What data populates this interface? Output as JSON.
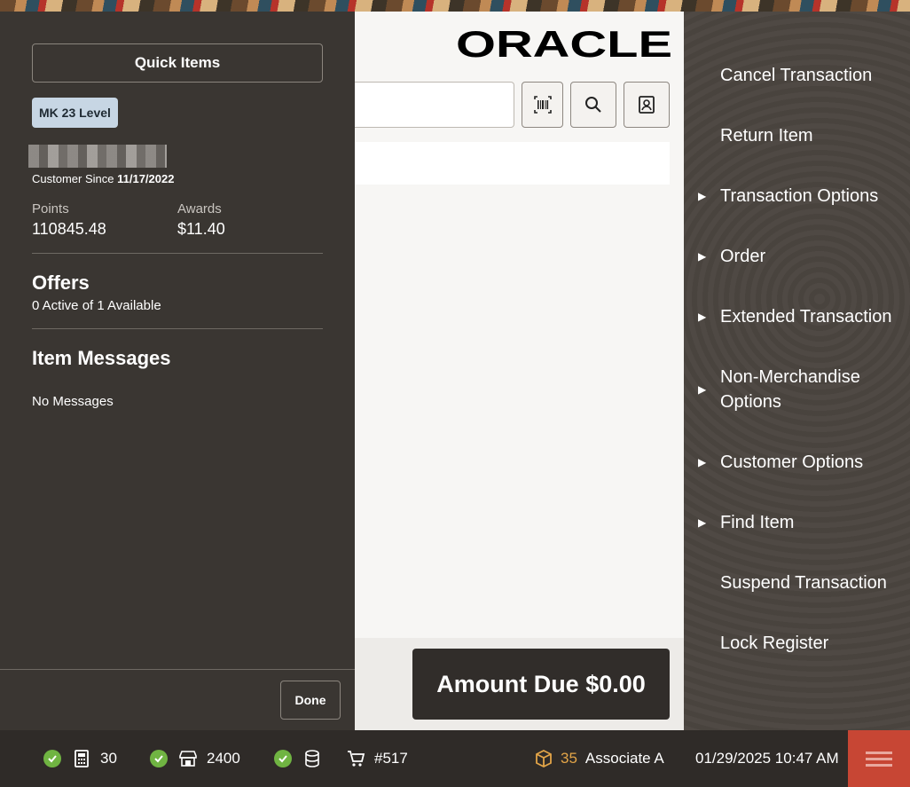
{
  "brand": {
    "logo_text": "ORACLE"
  },
  "left_panel": {
    "quick_items_label": "Quick Items",
    "level_badge": "MK 23 Level",
    "customer_since_label": "Customer Since",
    "customer_since_date": "11/17/2022",
    "points_label": "Points",
    "points_value": "110845.48",
    "awards_label": "Awards",
    "awards_value": "$11.40",
    "offers_title": "Offers",
    "offers_sub": "0 Active of 1 Available",
    "messages_title": "Item Messages",
    "messages_sub": "No Messages",
    "done_label": "Done"
  },
  "center": {
    "search_value": "",
    "amount_due_label": "Amount Due $0.00"
  },
  "menu": [
    {
      "label": "Cancel Transaction",
      "has_submenu": false
    },
    {
      "label": "Return Item",
      "has_submenu": false
    },
    {
      "label": "Transaction Options",
      "has_submenu": true
    },
    {
      "label": "Order",
      "has_submenu": true
    },
    {
      "label": "Extended Transaction",
      "has_submenu": true
    },
    {
      "label": "Non-Merchandise Options",
      "has_submenu": true
    },
    {
      "label": "Customer Options",
      "has_submenu": true
    },
    {
      "label": "Find Item",
      "has_submenu": true
    },
    {
      "label": "Suspend Transaction",
      "has_submenu": false
    },
    {
      "label": "Lock Register",
      "has_submenu": false
    }
  ],
  "menu_arrow": "▶",
  "status_bar": {
    "register": "30",
    "store": "2400",
    "cart": "#517",
    "associate_count": "35",
    "associate_name": "Associate A",
    "datetime": "01/29/2025 10:47 AM"
  },
  "colors": {
    "status_ok": "#70b442",
    "accent_red": "#c74634",
    "associate_badge": "#e3a548"
  }
}
